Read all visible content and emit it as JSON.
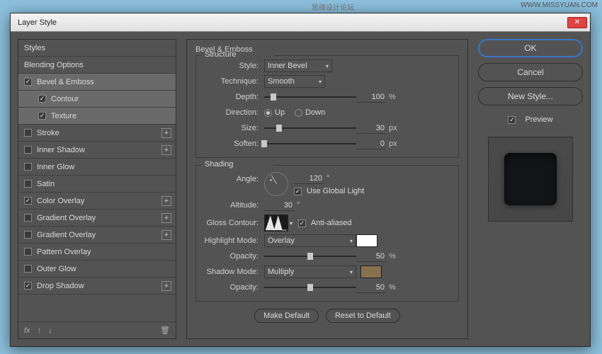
{
  "watermark_cn": "思缘设计论坛",
  "watermark_url": "WWW.MISSYUAN.COM",
  "title": "Layer Style",
  "styles_panel": {
    "header": "Styles",
    "blending": "Blending Options",
    "items": [
      {
        "label": "Bevel & Emboss",
        "checked": true,
        "selected": true,
        "plus": false,
        "sub": false
      },
      {
        "label": "Contour",
        "checked": true,
        "sub": true
      },
      {
        "label": "Texture",
        "checked": true,
        "sub": true
      },
      {
        "label": "Stroke",
        "checked": false,
        "plus": true
      },
      {
        "label": "Inner Shadow",
        "checked": false,
        "plus": true
      },
      {
        "label": "Inner Glow",
        "checked": false
      },
      {
        "label": "Satin",
        "checked": false
      },
      {
        "label": "Color Overlay",
        "checked": true,
        "plus": true
      },
      {
        "label": "Gradient Overlay",
        "checked": false,
        "plus": true
      },
      {
        "label": "Gradient Overlay",
        "checked": false,
        "plus": true
      },
      {
        "label": "Pattern Overlay",
        "checked": false
      },
      {
        "label": "Outer Glow",
        "checked": false
      },
      {
        "label": "Drop Shadow",
        "checked": true,
        "plus": true
      }
    ],
    "footer_fx": "fx"
  },
  "bevel": {
    "section": "Bevel & Emboss",
    "structure": "Structure",
    "style_label": "Style:",
    "style_value": "Inner Bevel",
    "technique_label": "Technique:",
    "technique_value": "Smooth",
    "depth_label": "Depth:",
    "depth_value": "100",
    "depth_unit": "%",
    "direction_label": "Direction:",
    "dir_up": "Up",
    "dir_down": "Down",
    "size_label": "Size:",
    "size_value": "30",
    "size_unit": "px",
    "soften_label": "Soften:",
    "soften_value": "0",
    "soften_unit": "px"
  },
  "shading": {
    "section": "Shading",
    "angle_label": "Angle:",
    "angle_value": "120",
    "angle_unit": "°",
    "use_global": "Use Global Light",
    "altitude_label": "Altitude:",
    "altitude_value": "30",
    "altitude_unit": "°",
    "gloss_label": "Gloss Contour:",
    "antialiased": "Anti-aliased",
    "highlight_label": "Highlight Mode:",
    "highlight_value": "Overlay",
    "highlight_color": "#ffffff",
    "h_opacity_label": "Opacity:",
    "h_opacity_value": "50",
    "h_opacity_unit": "%",
    "shadow_label": "Shadow Mode:",
    "shadow_value": "Multiply",
    "shadow_color": "#87714f",
    "s_opacity_label": "Opacity:",
    "s_opacity_value": "50",
    "s_opacity_unit": "%"
  },
  "buttons": {
    "make_default": "Make Default",
    "reset_default": "Reset to Default"
  },
  "side": {
    "ok": "OK",
    "cancel": "Cancel",
    "new_style": "New Style...",
    "preview": "Preview"
  }
}
